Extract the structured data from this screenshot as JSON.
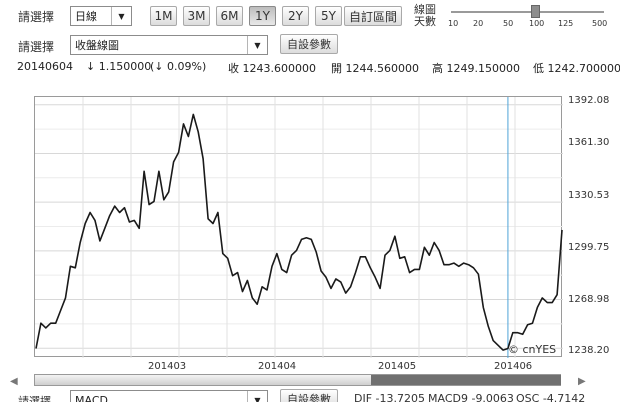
{
  "toolbar": {
    "select_label": "請選擇",
    "period_value": "日線",
    "ranges": [
      "1M",
      "3M",
      "6M",
      "1Y",
      "2Y",
      "5Y"
    ],
    "active_range": "1Y",
    "custom_range_label": "自訂區間",
    "days_label_line1": "線圖",
    "days_label_line2": "天數",
    "days_ticks": [
      "10",
      "20",
      "50",
      "100",
      "125",
      "500"
    ],
    "days_selected": "100"
  },
  "row2": {
    "select_label": "請選擇",
    "chart_type_value": "收盤線圖",
    "custom_params_label": "自設參數"
  },
  "quote": {
    "date": "20140604",
    "change": "↓ 1.150000",
    "change_pct": "(↓ 0.09%)",
    "close": "收 1243.600000",
    "open": "開 1244.560000",
    "high": "高 1249.150000",
    "low": "低 1242.700000"
  },
  "chart_data": {
    "type": "line",
    "title": "",
    "xlabel": "",
    "ylabel": "",
    "x_tick_labels": [
      "201403",
      "201404",
      "201405",
      "201406"
    ],
    "y_tick_labels": [
      "1392.08",
      "1361.30",
      "1330.53",
      "1299.75",
      "1268.98",
      "1238.20"
    ],
    "ylim": [
      1232,
      1397
    ],
    "grid": true,
    "series": [
      {
        "values": [
          1238,
          1254,
          1251,
          1254,
          1254,
          1262,
          1270,
          1290,
          1289,
          1305,
          1317,
          1324,
          1319,
          1306,
          1314,
          1322,
          1328,
          1324,
          1327,
          1318,
          1319,
          1314,
          1350,
          1329,
          1331,
          1350,
          1332,
          1337,
          1356,
          1362,
          1380,
          1372,
          1386,
          1375,
          1358,
          1320,
          1317,
          1324,
          1298,
          1295,
          1284,
          1286,
          1274,
          1281,
          1270,
          1266,
          1277,
          1275,
          1290,
          1298,
          1288,
          1286,
          1297,
          1300,
          1307,
          1308,
          1307,
          1299,
          1287,
          1283,
          1276,
          1282,
          1280,
          1273,
          1277,
          1286,
          1296,
          1296,
          1289,
          1283,
          1276,
          1297,
          1300,
          1309,
          1295,
          1296,
          1286,
          1288,
          1288,
          1302,
          1297,
          1305,
          1300,
          1291,
          1291,
          1292,
          1290,
          1292,
          1291,
          1289,
          1285,
          1264,
          1252,
          1243,
          1240,
          1237,
          1238,
          1248,
          1248,
          1247,
          1253,
          1254,
          1264,
          1270,
          1267,
          1267,
          1272,
          1313
        ]
      }
    ],
    "cursor_index": 96
  },
  "watermark": "© cnYES",
  "bottom": {
    "select_label": "請選擇",
    "indicator_value": "MACD",
    "custom_params_label": "自設參數",
    "dif": "DIF -13.7205",
    "macd9": "MACD9 -9.0063",
    "osc": "OSC -4.7142"
  },
  "scroll": {
    "left_arrow": "◀",
    "right_arrow": "▶"
  }
}
